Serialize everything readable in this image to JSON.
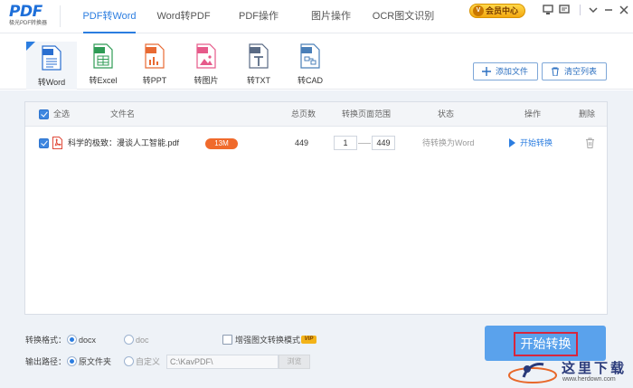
{
  "app": {
    "logo_text": "PDF",
    "logo_subtitle": "极光PDF转换器"
  },
  "nav": {
    "tabs": [
      {
        "label": "PDF转Word",
        "active": true
      },
      {
        "label": "Word转PDF",
        "active": false
      },
      {
        "label": "PDF操作",
        "active": false
      },
      {
        "label": "图片操作",
        "active": false
      },
      {
        "label": "OCR图文识别",
        "active": false
      }
    ],
    "vip_label": "会员中心"
  },
  "formats": [
    {
      "label": "转Word",
      "icon": "word-file-icon",
      "color": "#2b6fd0",
      "active": true
    },
    {
      "label": "转Excel",
      "icon": "excel-file-icon",
      "color": "#2f9b55",
      "active": false
    },
    {
      "label": "转PPT",
      "icon": "ppt-file-icon",
      "color": "#e86a33",
      "active": false
    },
    {
      "label": "转图片",
      "icon": "image-file-icon",
      "color": "#e65a8a",
      "active": false
    },
    {
      "label": "转TXT",
      "icon": "txt-file-icon",
      "color": "#5a6b85",
      "active": false
    },
    {
      "label": "转CAD",
      "icon": "cad-file-icon",
      "color": "#4a7fb8",
      "active": false
    }
  ],
  "toolbar": {
    "add_file_label": "添加文件",
    "clear_list_label": "清空列表"
  },
  "table": {
    "headers": {
      "select_all": "全选",
      "file_name": "文件名",
      "total_pages": "总页数",
      "page_range": "转换页面范围",
      "status": "状态",
      "action": "操作",
      "delete": "删除"
    },
    "rows": [
      {
        "file_name": "科学的极致：漫谈人工智能.pdf",
        "size": "13M",
        "total_pages": "449",
        "range_from": "1",
        "range_to": "449",
        "status": "待转换为Word",
        "action": "开始转换"
      }
    ]
  },
  "options": {
    "format_label": "转换格式：",
    "format_docx": "docx",
    "format_doc": "doc",
    "enhance_label": "增强图文转换模式",
    "vip_tag": "VIP",
    "output_label": "输出路径：",
    "output_original": "原文件夹",
    "output_custom": "自定义",
    "path_value": "C:\\KavPDF\\",
    "browse_label": "浏览"
  },
  "start_button_label": "开始转换",
  "watermark": {
    "text": "这里下载",
    "url": "www.herdown.com"
  },
  "colors": {
    "accent": "#2b7de0",
    "size_badge": "#f06a2c",
    "start_button": "#5aa2ec"
  }
}
